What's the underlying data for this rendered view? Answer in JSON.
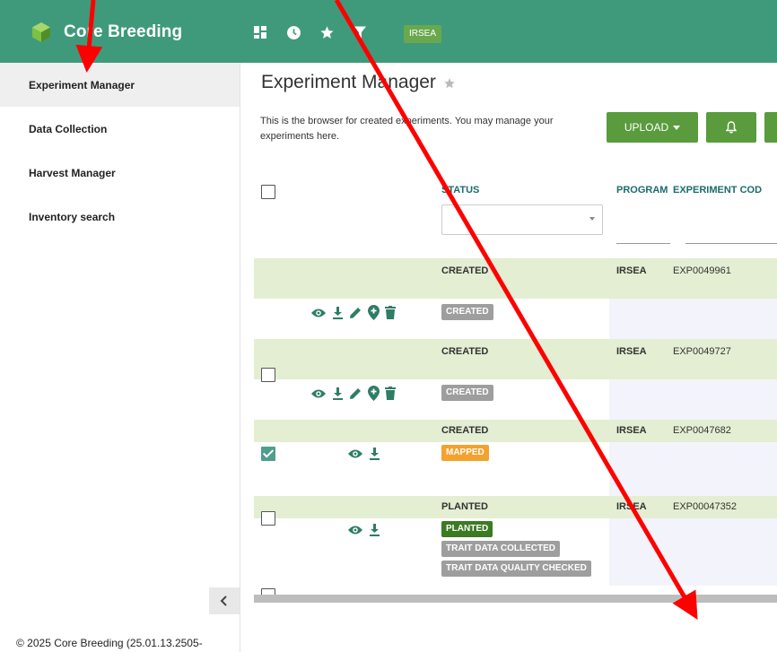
{
  "app": {
    "brand": "Core Breeding",
    "program_badge": "IRSEA",
    "top_icons": [
      "dashboard-icon",
      "clock-icon",
      "star-icon",
      "filter-icon"
    ]
  },
  "sidebar": {
    "items": [
      {
        "label": "Experiment Manager",
        "active": true
      },
      {
        "label": "Data Collection",
        "active": false
      },
      {
        "label": "Harvest Manager",
        "active": false
      },
      {
        "label": "Inventory search",
        "active": false
      }
    ],
    "footer": "© 2025 Core Breeding (25.01.13.2505-"
  },
  "page": {
    "title": "Experiment Manager",
    "description": "This is the browser for created experiments. You may manage your experiments here.",
    "upload_label": "UPLOAD"
  },
  "grid": {
    "columns": {
      "status": "STATUS",
      "program": "PROGRAM",
      "experiment_code": "EXPERIMENT COD"
    },
    "rows": [
      {
        "status": "CREATED",
        "program": "IRSEA",
        "code": "EXP0049961",
        "badges": [
          "CREATED"
        ],
        "checked": false,
        "actions": [
          "view",
          "download",
          "edit",
          "add-location",
          "delete"
        ]
      },
      {
        "status": "CREATED",
        "program": "IRSEA",
        "code": "EXP0049727",
        "badges": [
          "CREATED"
        ],
        "checked": true,
        "actions": [
          "view",
          "download",
          "edit",
          "add-location",
          "delete"
        ]
      },
      {
        "status": "CREATED",
        "program": "IRSEA",
        "code": "EXP0047682",
        "badges": [
          "MAPPED"
        ],
        "checked": false,
        "actions": [
          "view",
          "download"
        ]
      },
      {
        "status": "PLANTED",
        "program": "IRSEA",
        "code": "EXP00047352",
        "badges": [
          "PLANTED",
          "TRAIT DATA COLLECTED",
          "TRAIT DATA QUALITY CHECKED"
        ],
        "checked": false,
        "actions": [
          "view",
          "download"
        ]
      }
    ]
  },
  "colors": {
    "topbar": "#3f9a7b",
    "accent_button": "#599b3d",
    "summary_row": "#e3eed3",
    "annotation_arrow": "#ff0000"
  }
}
